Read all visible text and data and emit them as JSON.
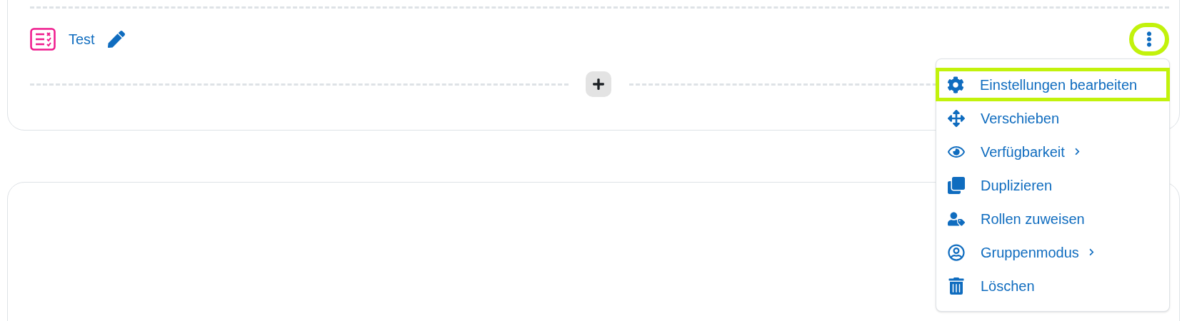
{
  "activity": {
    "title": "Test"
  },
  "more_button": {
    "highlighted": true
  },
  "menu": {
    "items": [
      {
        "label": "Einstellungen bearbeiten",
        "submenu": false,
        "highlighted": true
      },
      {
        "label": "Verschieben",
        "submenu": false,
        "highlighted": false
      },
      {
        "label": "Verfügbarkeit",
        "submenu": true,
        "highlighted": false
      },
      {
        "label": "Duplizieren",
        "submenu": false,
        "highlighted": false
      },
      {
        "label": "Rollen zuweisen",
        "submenu": false,
        "highlighted": false
      },
      {
        "label": "Gruppenmodus",
        "submenu": true,
        "highlighted": false
      },
      {
        "label": "Löschen",
        "submenu": false,
        "highlighted": false
      }
    ]
  }
}
